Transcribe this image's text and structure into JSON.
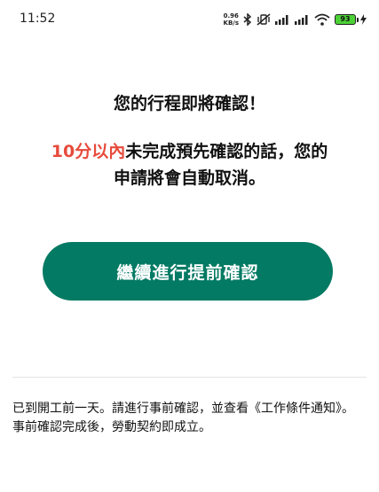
{
  "status_bar": {
    "time": "11:52",
    "net_speed_value": "0.96",
    "net_speed_unit": "KB/s",
    "battery_level": "93",
    "icons": [
      "bluetooth-icon",
      "vibrate-off-icon",
      "signal-icon",
      "signal-icon",
      "wifi-icon",
      "battery-icon",
      "charging-icon"
    ]
  },
  "main": {
    "title": "您的行程即將確認！",
    "warning_highlight": "10分以內",
    "warning_rest_line1": "未完成預先確認的話，您的",
    "warning_line2": "申請將會自動取消。",
    "confirm_button_label": "繼續進行提前確認"
  },
  "notice": {
    "line1": "已到開工前一天。請進行事前確認，並查看《工作條件通知》。",
    "line2": "事前確認完成後，勞動契約即成立。"
  },
  "colors": {
    "accent": "#037a63",
    "warning": "#e74b3c"
  }
}
